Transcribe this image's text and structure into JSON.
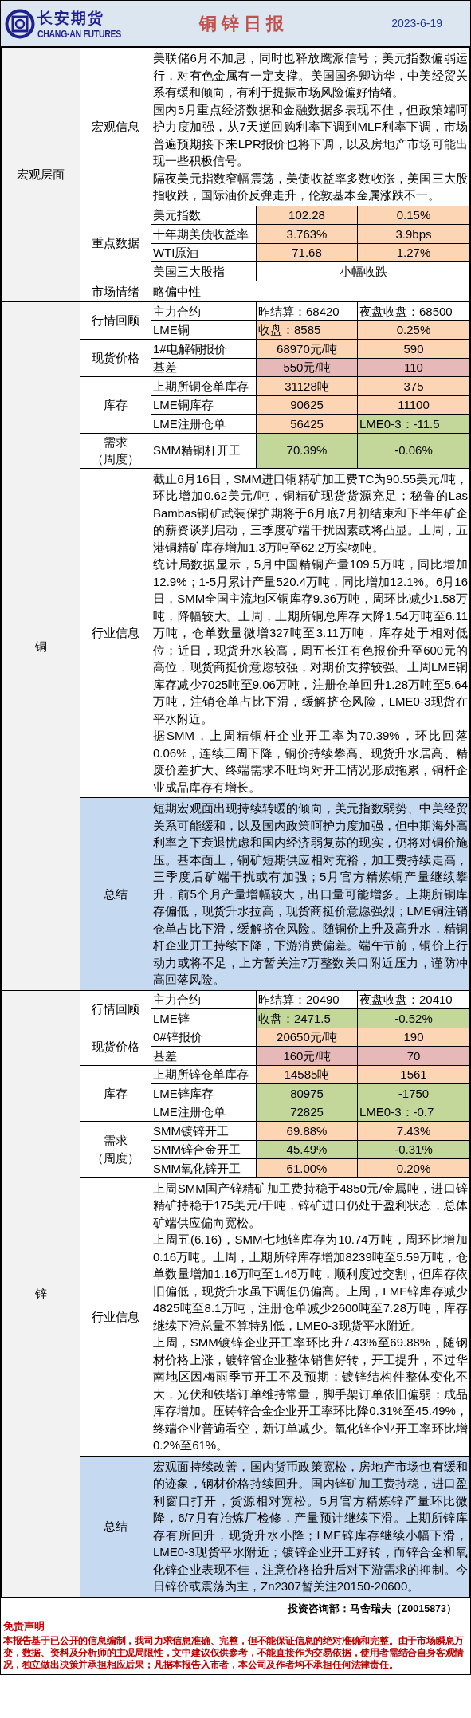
{
  "header": {
    "logo_cn": "长安期货",
    "logo_en": "CHANG-AN FUTURES",
    "title": "铜 锌 日 报",
    "date": "2023-6-19"
  },
  "sections": [
    {
      "name": "宏观层面",
      "groups": [
        {
          "kind": "text",
          "label": [
            "宏观信息"
          ],
          "paragraphs": [
            "美联储6月不加息，同时也释放鹰派信号；美元指数偏弱运行，对有色金属有一定支撑。美国国务卿访华，中美经贸关系有缓和倾向，有利于提振市场风险偏好情绪。",
            "国内5月重点经济数据和金融数据多表现不佳，但政策端呵护力度加强，从7天逆回购利率下调到MLF利率下调，市场普遍预期接下来LPR报价也将下调，以及房地产市场可能出现一些积极信号。",
            "隔夜美元指数窄幅震荡，美债收益率多数收涨，美国三大股指收跌，国际油价反弹走升，伦敦基本金属涨跌不一。"
          ]
        },
        {
          "kind": "table",
          "label": [
            "重点数据"
          ],
          "rows": [
            {
              "label": "美元指数",
              "values": [
                {
                  "text": "102.28",
                  "kind": "plain",
                  "color": "#fcd5b4"
                },
                {
                  "text": "0.15%",
                  "kind": "plain",
                  "color": "#fcd5b4"
                }
              ]
            },
            {
              "label": "十年期美债收益率",
              "values": [
                {
                  "text": "3.763%",
                  "kind": "plain",
                  "color": "#fcd5b4"
                },
                {
                  "text": "3.9bps",
                  "kind": "plain",
                  "color": "#fcd5b4"
                }
              ]
            },
            {
              "label": "WTI原油",
              "values": [
                {
                  "text": "71.68",
                  "kind": "plain",
                  "color": "#fcd5b4"
                },
                {
                  "text": "1.27%",
                  "kind": "plain",
                  "color": "#fcd5b4"
                }
              ]
            },
            {
              "label": "美国三大股指",
              "values": [
                {
                  "text": "小幅收跌",
                  "kind": "plain"
                }
              ]
            }
          ]
        },
        {
          "kind": "text",
          "label": [
            "市场情绪"
          ],
          "paragraphs": [
            "略偏中性"
          ]
        }
      ]
    },
    {
      "name": "铜",
      "groups": [
        {
          "kind": "table",
          "label": [
            "行情回顾"
          ],
          "rows": [
            {
              "label": "主力合约",
              "values": [
                {
                  "text": "昨结算：68420",
                  "kind": "labelled"
                },
                {
                  "text": "夜盘收盘：68500",
                  "kind": "labelled"
                }
              ]
            },
            {
              "label": "LME铜",
              "values": [
                {
                  "text": "收盘：8585",
                  "kind": "labelled",
                  "color": "#fcd5b4"
                },
                {
                  "text": "0.25%",
                  "kind": "plain",
                  "color": "#fcd5b4"
                }
              ]
            }
          ]
        },
        {
          "kind": "table",
          "label": [
            "现货价格"
          ],
          "rows": [
            {
              "label": "1#电解铜报价",
              "values": [
                {
                  "text": "68970元/吨",
                  "kind": "plain",
                  "color": "#fcd5b4"
                },
                {
                  "text": "590",
                  "kind": "plain",
                  "color": "#fcd5b4"
                }
              ]
            },
            {
              "label": "基差",
              "values": [
                {
                  "text": "550元/吨",
                  "kind": "plain",
                  "color": "#e6b8b7"
                },
                {
                  "text": "110",
                  "kind": "plain",
                  "color": "#e6b8b7"
                }
              ]
            }
          ]
        },
        {
          "kind": "table",
          "label": [
            "库存"
          ],
          "rows": [
            {
              "label": "上期所铜仓单库存",
              "values": [
                {
                  "text": "31128吨",
                  "kind": "plain",
                  "color": "#fcd5b4"
                },
                {
                  "text": "375",
                  "kind": "plain",
                  "color": "#fcd5b4"
                }
              ]
            },
            {
              "label": "LME铜库存",
              "values": [
                {
                  "text": "90625",
                  "kind": "plain",
                  "color": "#fcd5b4"
                },
                {
                  "text": "11100",
                  "kind": "plain",
                  "color": "#fcd5b4"
                }
              ]
            },
            {
              "label": "LME注册仓单",
              "values": [
                {
                  "text": "56425",
                  "kind": "plain",
                  "color": "#fcd5b4"
                },
                {
                  "text": "LME0-3：-11.5",
                  "kind": "labelled",
                  "color": "#c4d79b"
                }
              ]
            }
          ]
        },
        {
          "kind": "table",
          "label": [
            "需求",
            "（周度）"
          ],
          "rows": [
            {
              "label": "SMM精铜杆开工",
              "values": [
                {
                  "text": "70.39%",
                  "kind": "plain",
                  "color": "#c4d79b"
                },
                {
                  "text": "-0.06%",
                  "kind": "plain",
                  "color": "#c4d79b"
                }
              ]
            }
          ]
        },
        {
          "kind": "text",
          "label": [
            "行业信息"
          ],
          "paragraphs": [
            "截止6月16日，SMM进口铜精矿加工费TC为90.55美元/吨，环比增加0.62美元/吨，铜精矿现货货源充足；秘鲁的Las Bambas铜矿武装保护期将于6月底7月初结束和下半年矿企的薪资谈判启动，三季度矿端干扰因素或将凸显。上周，五港铜精矿库存增加1.3万吨至62.2万实物吨。",
            "统计局数据显示，5月中国精铜产量109.5万吨，同比增加12.9%；1-5月累计产量520.4万吨，同比增加12.1%。6月16日，SMM全国主流地区铜库存9.36万吨，周环比减少1.58万吨，降幅较大。上周，上期所铜总库存大降1.54万吨至6.11万吨，仓单数量微增327吨至3.11万吨，库存处于相对低位；近日，现货升水较高，周五长江有色报价升至600元的高位，现货商挺价意愿较强，对期价支撑较强。上周LME铜库存减少7025吨至9.06万吨，注册仓单回升1.28万吨至5.64万吨，注销仓单占比下滑，缓解挤仓风险，LME0-3现货在平水附近。",
            "据SMM，上周精铜杆企业开工率为70.39%，环比回落0.06%，连续三周下降，铜价持续攀高、现货升水居高、精废价差扩大、终端需求不旺均对开工情况形成拖累，铜杆企业成品库存有增长。"
          ]
        },
        {
          "kind": "summary",
          "label": [
            "总结"
          ],
          "paragraphs": [
            "短期宏观面出现持续转暖的倾向，美元指数弱势、中美经贸关系可能缓和，以及国内政策呵护力度加强，但中期海外高利率之下衰退忧虑和国内经济弱复苏的现实，仍将对铜价施压。基本面上，铜矿短期供应相对充裕，加工费持续走高，三季度后矿端干扰或有加强；5月官方精炼铜产量继续攀升，前5个月产量增幅较大，出口量可能增多。上期所铜库存偏低，现货升水拉高，现货商挺价意愿强烈；LME铜注销仓单占比下滑，缓解挤仓风险。随铜价上升及高升水，精铜杆企业开工持续下降，下游消费偏差。端午节前，铜价上行动力或将不足，上方暂关注7万整数关口附近压力，谨防冲高回落风险。"
          ]
        }
      ]
    },
    {
      "name": "锌",
      "groups": [
        {
          "kind": "table",
          "label": [
            "行情回顾"
          ],
          "rows": [
            {
              "label": "主力合约",
              "values": [
                {
                  "text": "昨结算：20490",
                  "kind": "labelled"
                },
                {
                  "text": "夜盘收盘：20410",
                  "kind": "labelled"
                }
              ]
            },
            {
              "label": "LME锌",
              "values": [
                {
                  "text": "收盘：2471.5",
                  "kind": "labelled",
                  "color": "#c4d79b"
                },
                {
                  "text": "-0.52%",
                  "kind": "plain",
                  "color": "#c4d79b"
                }
              ]
            }
          ]
        },
        {
          "kind": "table",
          "label": [
            "现货价格"
          ],
          "rows": [
            {
              "label": "0#锌报价",
              "values": [
                {
                  "text": "20650元/吨",
                  "kind": "plain",
                  "color": "#fcd5b4"
                },
                {
                  "text": "190",
                  "kind": "plain",
                  "color": "#fcd5b4"
                }
              ]
            },
            {
              "label": "基差",
              "values": [
                {
                  "text": "160元/吨",
                  "kind": "plain",
                  "color": "#e6b8b7"
                },
                {
                  "text": "70",
                  "kind": "plain",
                  "color": "#e6b8b7"
                }
              ]
            }
          ]
        },
        {
          "kind": "table",
          "label": [
            "库存"
          ],
          "rows": [
            {
              "label": "上期所锌仓单库存",
              "values": [
                {
                  "text": "14585吨",
                  "kind": "plain",
                  "color": "#fcd5b4"
                },
                {
                  "text": "1561",
                  "kind": "plain",
                  "color": "#fcd5b4"
                }
              ]
            },
            {
              "label": "LME锌库存",
              "values": [
                {
                  "text": "80975",
                  "kind": "plain",
                  "color": "#c4d79b"
                },
                {
                  "text": "-1750",
                  "kind": "plain",
                  "color": "#c4d79b"
                }
              ]
            },
            {
              "label": "LME注册仓单",
              "values": [
                {
                  "text": "72825",
                  "kind": "plain",
                  "color": "#c4d79b"
                },
                {
                  "text": "LME0-3：-0.7",
                  "kind": "labelled",
                  "color": "#c4d79b"
                }
              ]
            }
          ]
        },
        {
          "kind": "table",
          "label": [
            "需求",
            "（周度）"
          ],
          "rows": [
            {
              "label": "SMM镀锌开工",
              "values": [
                {
                  "text": "69.88%",
                  "kind": "plain",
                  "color": "#fcd5b4"
                },
                {
                  "text": "7.43%",
                  "kind": "plain",
                  "color": "#fcd5b4"
                }
              ]
            },
            {
              "label": "SMM锌合金开工",
              "values": [
                {
                  "text": "45.49%",
                  "kind": "plain",
                  "color": "#c4d79b"
                },
                {
                  "text": "-0.31%",
                  "kind": "plain",
                  "color": "#c4d79b"
                }
              ]
            },
            {
              "label": "SMM氧化锌开工",
              "values": [
                {
                  "text": "61.00%",
                  "kind": "plain",
                  "color": "#fcd5b4"
                },
                {
                  "text": "0.20%",
                  "kind": "plain",
                  "color": "#fcd5b4"
                }
              ]
            }
          ]
        },
        {
          "kind": "text",
          "label": [
            "行业信息"
          ],
          "paragraphs": [
            "上周SMM国产锌精矿加工费持稳于4850元/金属吨，进口锌精矿持稳于175美元/干吨，锌矿进口仍处于盈利状态，总体矿端供应偏向宽松。",
            "上周五(6.16)，SMM七地锌库存为10.74万吨，周环比增加0.16万吨。上周，上期所锌库存增加8239吨至5.59万吨，仓单数量增加1.16万吨至1.46万吨，顺利度过交割，但库存依旧偏低，现货升水虽下调但仍偏高。上周，LME锌库存减少4825吨至8.1万吨，注册仓单减少2600吨至7.28万吨，库存继续下滑总量不算特别低，LME0-3现货平水附近。",
            "上周，SMM镀锌企业开工率环比升7.43%至69.88%，随钢材价格上涨，镀锌管企业整体销售好转，开工提升，不过华南地区因梅雨季节开工不及预期；镀锌结构件整体变化不大，光伏和铁塔订单维持常量，脚手架订单依旧偏弱；成品库存增加。压铸锌合金企业开工率环比降0.31%至45.49%，终端企业普遍看空，新订单减少。氧化锌企业开工率环比增0.2%至61%。"
          ]
        },
        {
          "kind": "summary",
          "label": [
            "总结"
          ],
          "paragraphs": [
            "宏观面持续改善，国内货币政策宽松，房地产市场也有缓和的迹象，钢材价格持续回升。国内锌矿加工费持稳，进口盈利窗口打开，货源相对宽松。5月官方精炼锌产量环比微降，6/7月有冶炼厂检修，产量预计继续下滑。上期所锌库存有所回升，现货升水小降；LME锌库存继续小幅下滑，LME0-3现货平水附近；镀锌企业开工好转，而锌合金和氧化锌企业表现不佳，注意价格抬升后对下游需求的抑制。今日锌价或震荡为主，Zn2307暂关注20150-20600。"
          ]
        }
      ]
    }
  ],
  "footer": {
    "analyst": "投资咨询部：马舍瑞夫（Z0015873）",
    "disclaimer_title": "免责声明",
    "disclaimer": "本报告基于已公开的信息编制，我司力求信息准确、完整，但不能保证信息的绝对准确和完整。由于市场瞬息万变，数据、资料及分析师的主观局限性，文中建议仅供参考，不能直接作为交易依据，使用者需结合自身客观情况，独立做出决策并承担相应后果；凡据本报告入市者，本公司及作者均不承担任何法律责任。"
  }
}
